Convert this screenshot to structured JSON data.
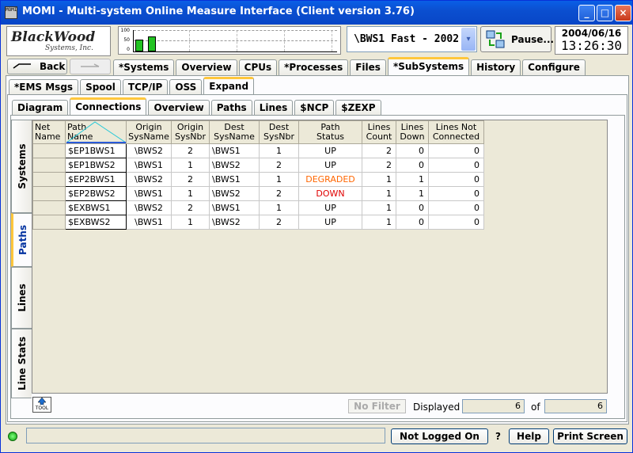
{
  "window": {
    "title": "MOMI - Multi-system Online Measure Interface (Client version 3.76)",
    "icon_text": "MOMI",
    "minimize": "_",
    "maximize": "□",
    "close": "×"
  },
  "logo": {
    "line1": "BlackWood",
    "line2": "Systems, Inc."
  },
  "gauge": {
    "tick_100": "100",
    "tick_50": "50",
    "tick_0": "0",
    "bars": [
      0.55,
      0.7
    ]
  },
  "system_select": {
    "value": "\\BWS1 Fast - 2002",
    "arrow": "▾"
  },
  "pause_label": "Pause...",
  "datetime": {
    "date": "2004/06/16",
    "time": "13:26:30"
  },
  "nav": {
    "back": "Back",
    "back_icon": "arrow-left-icon",
    "forward_icon": "arrow-right-icon"
  },
  "main_tabs": [
    "*Systems",
    "Overview",
    "CPUs",
    "*Processes",
    "Files",
    "*SubSystems",
    "History",
    "Configure"
  ],
  "main_active": "*SubSystems",
  "sub_tabs": [
    "*EMS Msgs",
    "Spool",
    "TCP/IP",
    "OSS",
    "Expand"
  ],
  "sub_active": "Expand",
  "expand_tabs": [
    "Diagram",
    "Connections",
    "Overview",
    "Paths",
    "Lines",
    "$NCP",
    "$ZEXP"
  ],
  "expand_active": "Connections",
  "side_tabs": [
    "Systems",
    "Paths",
    "Lines",
    "Line Stats"
  ],
  "side_active": "Paths",
  "table": {
    "columns": [
      {
        "l1": "Net",
        "l2": "Name"
      },
      {
        "l1": "Path",
        "l2": "Name"
      },
      {
        "l1": "Origin",
        "l2": "SysName"
      },
      {
        "l1": "Origin",
        "l2": "SysNbr"
      },
      {
        "l1": "Dest",
        "l2": "SysName"
      },
      {
        "l1": "Dest",
        "l2": "SysNbr"
      },
      {
        "l1": "Path",
        "l2": "Status"
      },
      {
        "l1": "Lines",
        "l2": "Count"
      },
      {
        "l1": "Lines",
        "l2": "Down"
      },
      {
        "l1": "Lines Not",
        "l2": "Connected"
      }
    ],
    "rows": [
      {
        "net": "",
        "path": "$EP1BWS1",
        "osys": "\\BWS2",
        "onbr": "2",
        "dsys": "\\BWS1",
        "dnbr": "1",
        "status": "UP",
        "count": "2",
        "down": "0",
        "notconn": "0"
      },
      {
        "net": "",
        "path": "$EP1BWS2",
        "osys": "\\BWS1",
        "onbr": "1",
        "dsys": "\\BWS2",
        "dnbr": "2",
        "status": "UP",
        "count": "2",
        "down": "0",
        "notconn": "0"
      },
      {
        "net": "",
        "path": "$EP2BWS1",
        "osys": "\\BWS2",
        "onbr": "2",
        "dsys": "\\BWS1",
        "dnbr": "1",
        "status": "DEGRADED",
        "count": "1",
        "down": "1",
        "notconn": "0"
      },
      {
        "net": "",
        "path": "$EP2BWS2",
        "osys": "\\BWS1",
        "onbr": "1",
        "dsys": "\\BWS2",
        "dnbr": "2",
        "status": "DOWN",
        "count": "1",
        "down": "1",
        "notconn": "0"
      },
      {
        "net": "",
        "path": "$EXBWS1",
        "osys": "\\BWS2",
        "onbr": "2",
        "dsys": "\\BWS1",
        "dnbr": "1",
        "status": "UP",
        "count": "1",
        "down": "0",
        "notconn": "0"
      },
      {
        "net": "",
        "path": "$EXBWS2",
        "osys": "\\BWS1",
        "onbr": "1",
        "dsys": "\\BWS2",
        "dnbr": "2",
        "status": "UP",
        "count": "1",
        "down": "0",
        "notconn": "0"
      }
    ],
    "status_colors": {
      "UP": "#000000",
      "DEGRADED": "#ff6600",
      "DOWN": "#e00000"
    }
  },
  "footer": {
    "tool_label": "TOOL",
    "no_filter": "No Filter",
    "displayed_label": "Displayed",
    "displayed_value": "6",
    "of_label": "of",
    "total_value": "6"
  },
  "statusbar": {
    "status_text": "",
    "login": "Not Logged On",
    "question": "?",
    "help": "Help",
    "print": "Print Screen"
  }
}
